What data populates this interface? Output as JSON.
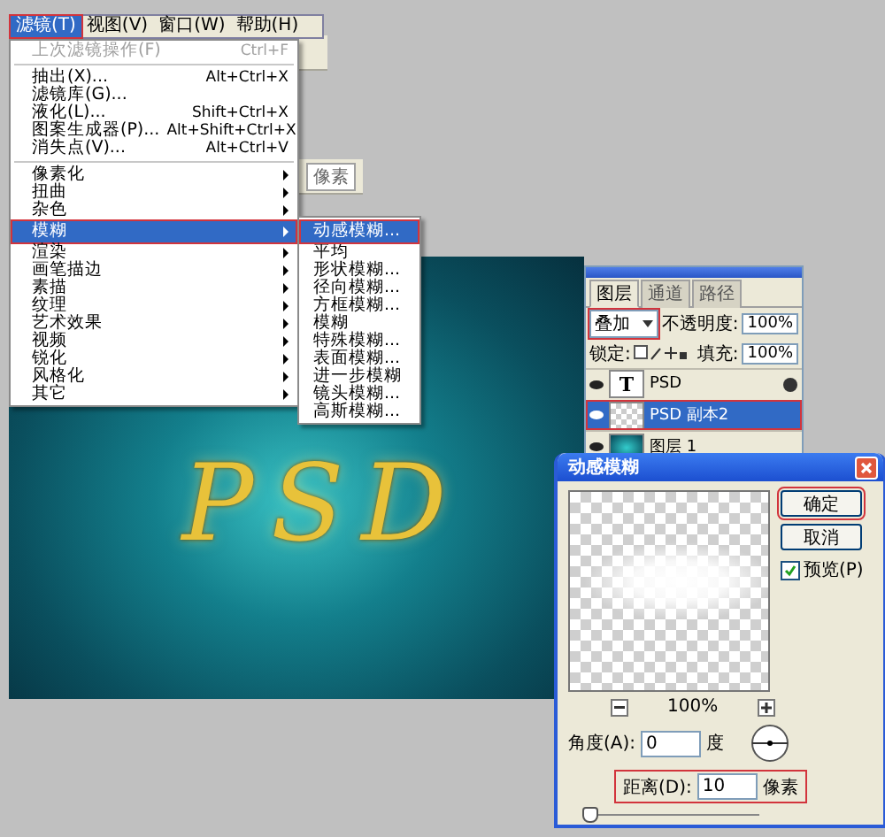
{
  "menu_bar": {
    "items": [
      {
        "label": "滤镜(T)",
        "selected": true,
        "highlighted": true
      },
      {
        "label": "视图(V)",
        "selected": false,
        "highlighted": false
      },
      {
        "label": "窗口(W)",
        "selected": false,
        "highlighted": false
      },
      {
        "label": "帮助(H)",
        "selected": false,
        "highlighted": false
      }
    ]
  },
  "background_toolbar": {
    "field_text": "像素"
  },
  "filter_menu": {
    "items": [
      {
        "kind": "item",
        "label": "上次滤镜操作(F)",
        "shortcut": "Ctrl+F",
        "disabled": true
      },
      {
        "kind": "divider"
      },
      {
        "kind": "item",
        "label": "抽出(X)...",
        "shortcut": "Alt+Ctrl+X",
        "disabled": false
      },
      {
        "kind": "item",
        "label": "滤镜库(G)...",
        "disabled": false
      },
      {
        "kind": "item",
        "label": "液化(L)...",
        "shortcut": "Shift+Ctrl+X",
        "disabled": false
      },
      {
        "kind": "item",
        "label": "图案生成器(P)...",
        "shortcut": "Alt+Shift+Ctrl+X",
        "disabled": false
      },
      {
        "kind": "item",
        "label": "消失点(V)...",
        "shortcut": "Alt+Ctrl+V",
        "disabled": false
      },
      {
        "kind": "divider"
      },
      {
        "kind": "submenu",
        "label": "像素化",
        "selected": false
      },
      {
        "kind": "submenu",
        "label": "扭曲",
        "selected": false
      },
      {
        "kind": "submenu",
        "label": "杂色",
        "selected": false
      },
      {
        "kind": "submenu",
        "label": "模糊",
        "selected": true,
        "highlighted": true,
        "children": [
          {
            "label": "动感模糊...",
            "selected": true,
            "highlighted": true
          },
          {
            "label": "平均",
            "selected": false,
            "highlighted": false
          },
          {
            "label": "形状模糊...",
            "selected": false,
            "highlighted": false
          },
          {
            "label": "径向模糊...",
            "selected": false,
            "highlighted": false
          },
          {
            "label": "方框模糊...",
            "selected": false,
            "highlighted": false
          },
          {
            "label": "模糊",
            "selected": false,
            "highlighted": false
          },
          {
            "label": "特殊模糊...",
            "selected": false,
            "highlighted": false
          },
          {
            "label": "表面模糊...",
            "selected": false,
            "highlighted": false
          },
          {
            "label": "进一步模糊",
            "selected": false,
            "highlighted": false
          },
          {
            "label": "镜头模糊...",
            "selected": false,
            "highlighted": false
          },
          {
            "label": "高斯模糊...",
            "selected": false,
            "highlighted": false
          }
        ]
      },
      {
        "kind": "submenu",
        "label": "渲染",
        "selected": false
      },
      {
        "kind": "submenu",
        "label": "画笔描边",
        "selected": false
      },
      {
        "kind": "submenu",
        "label": "素描",
        "selected": false
      },
      {
        "kind": "submenu",
        "label": "纹理",
        "selected": false
      },
      {
        "kind": "submenu",
        "label": "艺术效果",
        "selected": false
      },
      {
        "kind": "submenu",
        "label": "视频",
        "selected": false
      },
      {
        "kind": "submenu",
        "label": "锐化",
        "selected": false
      },
      {
        "kind": "submenu",
        "label": "风格化",
        "selected": false
      },
      {
        "kind": "submenu",
        "label": "其它",
        "selected": false
      }
    ]
  },
  "canvas": {
    "text": "PSD"
  },
  "layers_panel": {
    "tabs": [
      {
        "label": "图层",
        "selected": true
      },
      {
        "label": "通道",
        "selected": false
      },
      {
        "label": "路径",
        "selected": false
      }
    ],
    "blend_mode": {
      "value": "叠加",
      "highlighted": true
    },
    "opacity_label": "不透明度:",
    "opacity": "100%",
    "lock_label": "锁定:",
    "fill_label": "填充:",
    "fill": "100%",
    "layers": [
      {
        "kind": "text",
        "name": "PSD",
        "thumbnail_text": "T",
        "selected": false,
        "highlighted": false,
        "effects": true
      },
      {
        "kind": "image",
        "name": "PSD 副本2",
        "selected": true,
        "highlighted": true,
        "effects": false
      },
      {
        "kind": "fill",
        "name": "图层 1",
        "selected": false,
        "highlighted": false,
        "effects": false
      }
    ]
  },
  "dialog": {
    "title": "动感模糊",
    "ok": {
      "label": "确定",
      "highlighted": true
    },
    "cancel": {
      "label": "取消"
    },
    "preview": {
      "label": "预览(P)",
      "checked": true
    },
    "zoom": "100%",
    "angle": {
      "label": "角度(A):",
      "value": "0",
      "unit": "度"
    },
    "distance": {
      "label": "距离(D):",
      "value": "10",
      "unit": "像素",
      "highlighted": true
    },
    "slider": {
      "level": 0.03
    }
  }
}
